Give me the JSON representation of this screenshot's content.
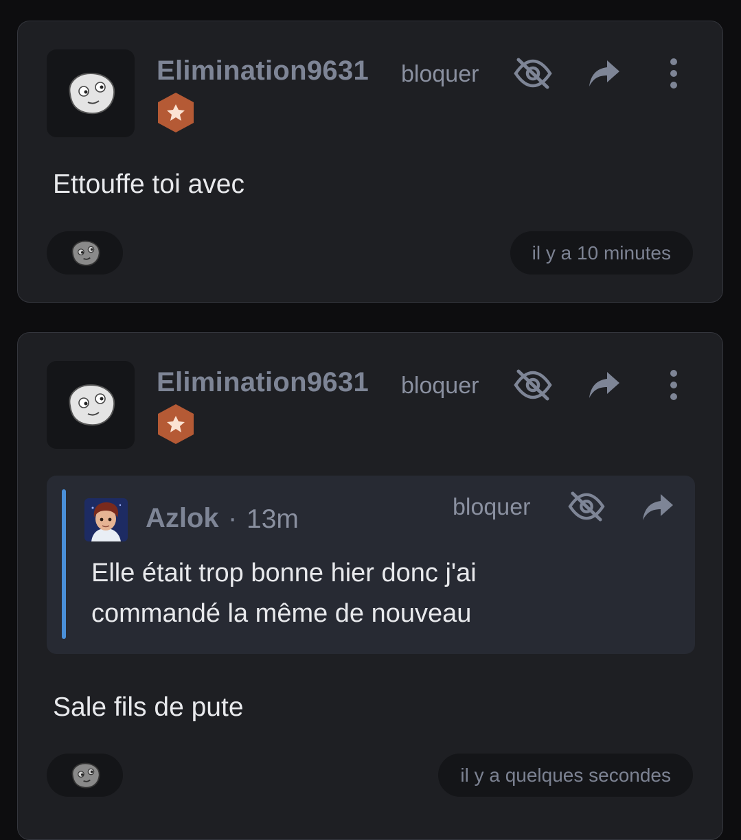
{
  "comments": [
    {
      "author": "Elimination9631",
      "block_label": "bloquer",
      "body": "Ettouffe toi avec",
      "time": "il y a 10 minutes",
      "badge_color": "#b55a35",
      "icons": [
        "smiley-face-icon",
        "star-badge-icon",
        "eye-off-icon",
        "share-arrow-icon",
        "more-vertical-icon",
        "reaction-smiley-icon"
      ]
    },
    {
      "author": "Elimination9631",
      "block_label": "bloquer",
      "body": "Sale fils de pute",
      "time": "il y a quelques secondes",
      "badge_color": "#b55a35",
      "quote": {
        "author": "Azlok",
        "separator": "·",
        "time": "13m",
        "block_label": "bloquer",
        "text": "Elle était trop bonne hier donc j'ai commandé la même de nouveau",
        "accent_color": "#4a8fd8"
      }
    }
  ]
}
